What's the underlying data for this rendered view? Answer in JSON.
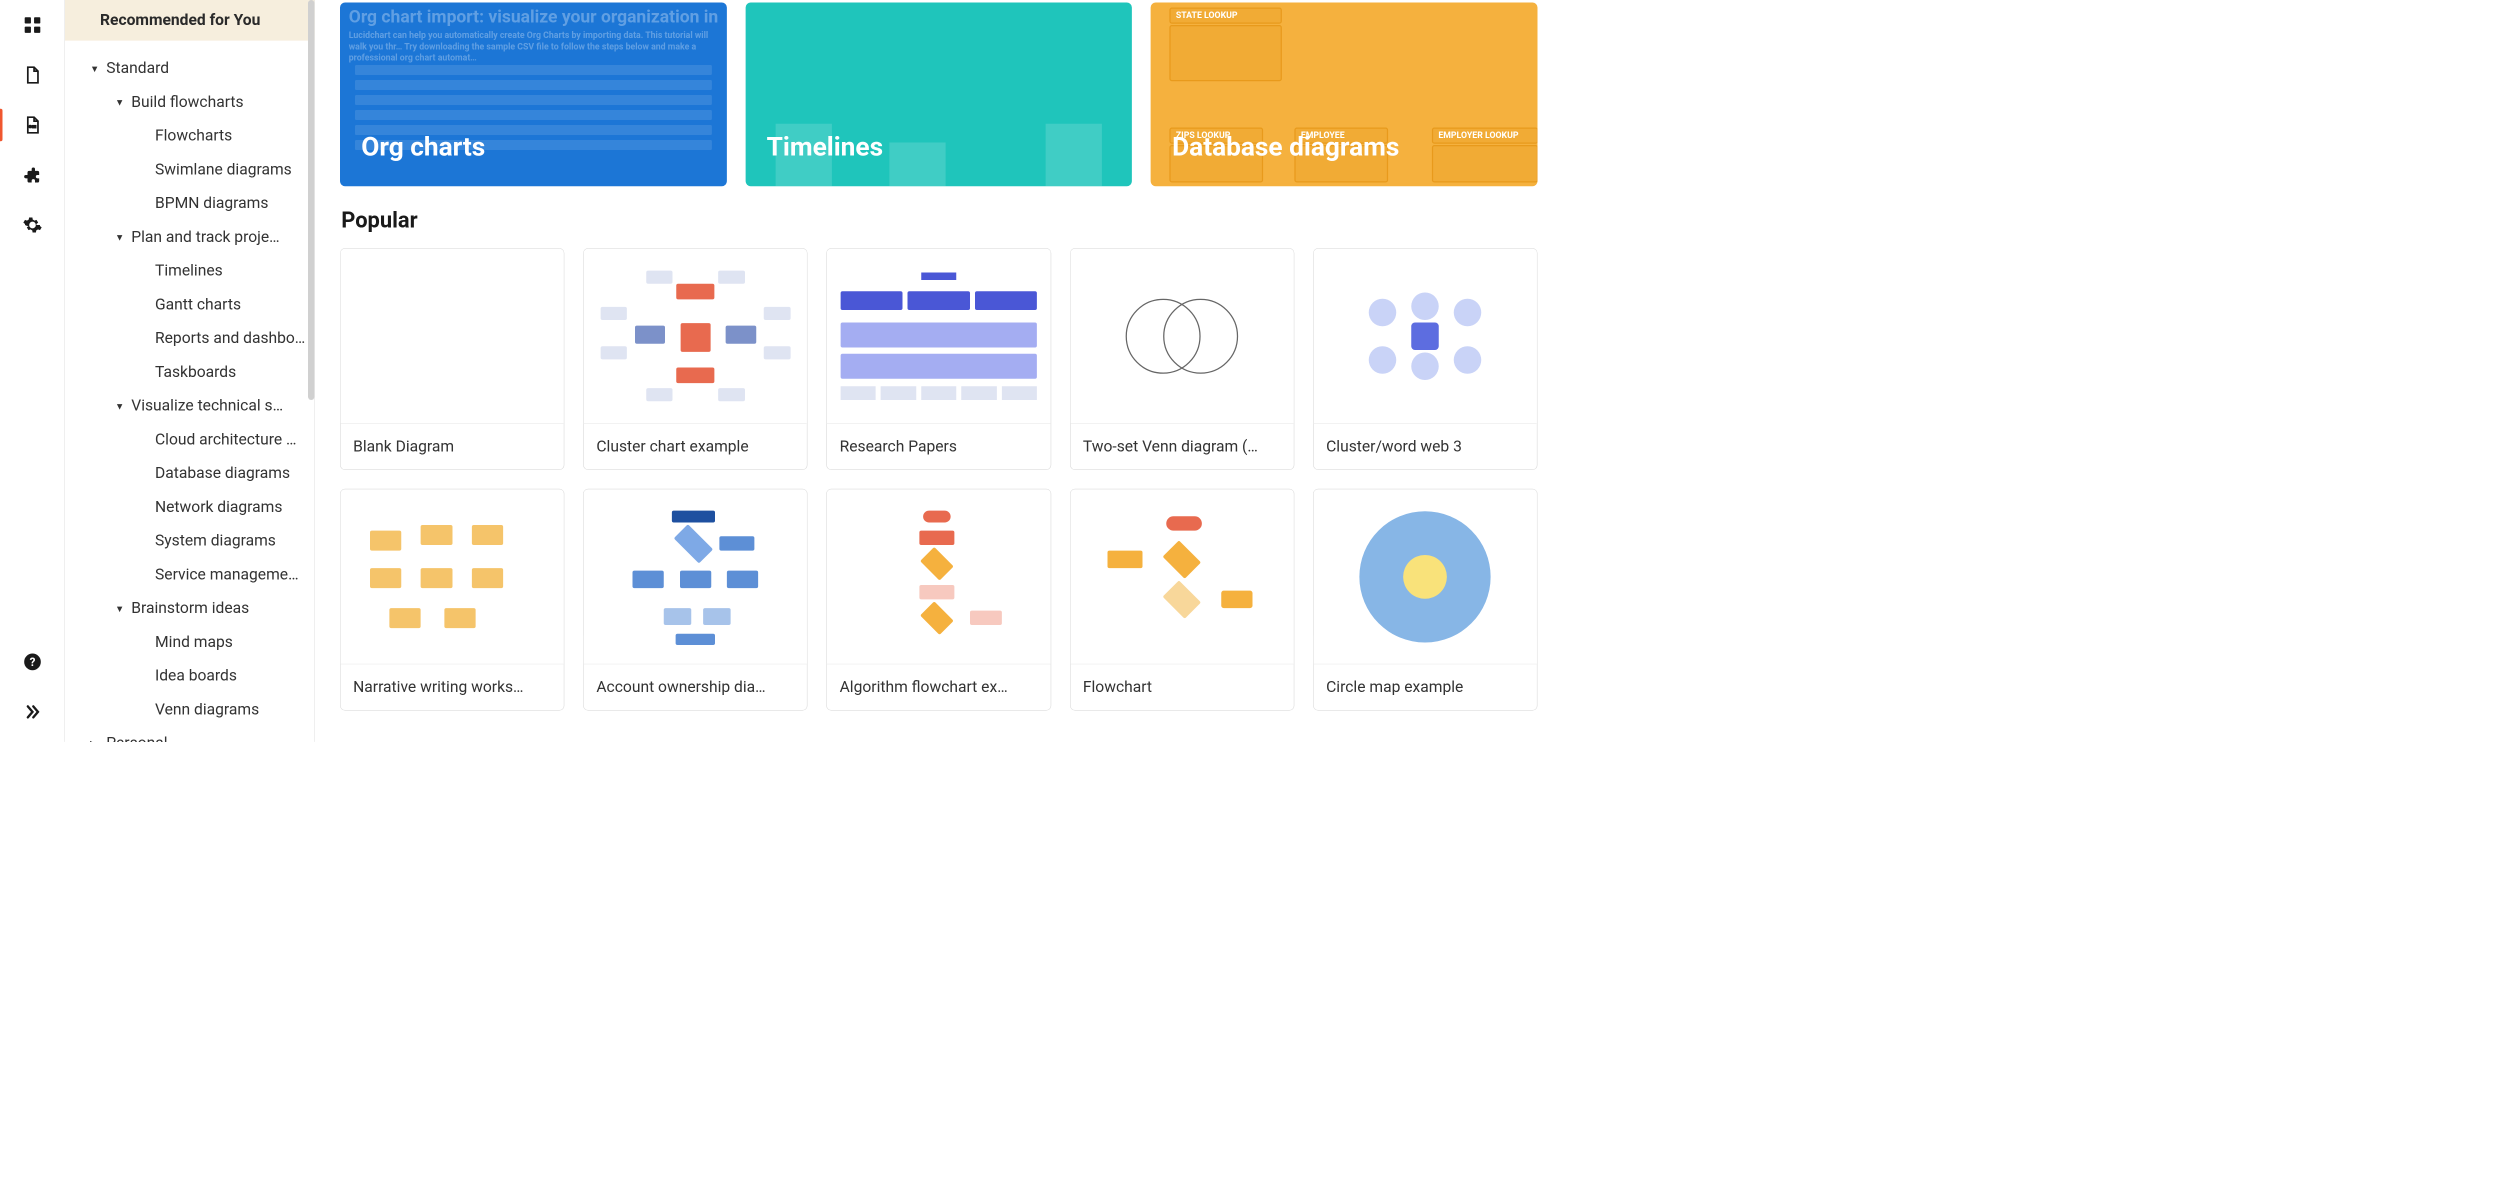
{
  "sidebar": {
    "recommended": "Recommended for You",
    "tree": [
      {
        "level": 0,
        "label": "Standard",
        "arrow": "down"
      },
      {
        "level": 1,
        "label": "Build flowcharts",
        "arrow": "down"
      },
      {
        "level": 2,
        "label": "Flowcharts",
        "arrow": ""
      },
      {
        "level": 2,
        "label": "Swimlane diagrams",
        "arrow": ""
      },
      {
        "level": 2,
        "label": "BPMN diagrams",
        "arrow": ""
      },
      {
        "level": 1,
        "label": "Plan and track proje…",
        "arrow": "down"
      },
      {
        "level": 2,
        "label": "Timelines",
        "arrow": ""
      },
      {
        "level": 2,
        "label": "Gantt charts",
        "arrow": ""
      },
      {
        "level": 2,
        "label": "Reports and dashbo…",
        "arrow": ""
      },
      {
        "level": 2,
        "label": "Taskboards",
        "arrow": ""
      },
      {
        "level": 1,
        "label": "Visualize technical s…",
        "arrow": "down"
      },
      {
        "level": 2,
        "label": "Cloud architecture …",
        "arrow": ""
      },
      {
        "level": 2,
        "label": "Database diagrams",
        "arrow": ""
      },
      {
        "level": 2,
        "label": "Network diagrams",
        "arrow": ""
      },
      {
        "level": 2,
        "label": "System diagrams",
        "arrow": ""
      },
      {
        "level": 2,
        "label": "Service manageme…",
        "arrow": ""
      },
      {
        "level": 1,
        "label": "Brainstorm ideas",
        "arrow": "down"
      },
      {
        "level": 2,
        "label": "Mind maps",
        "arrow": ""
      },
      {
        "level": 2,
        "label": "Idea boards",
        "arrow": ""
      },
      {
        "level": 2,
        "label": "Venn diagrams",
        "arrow": ""
      },
      {
        "level": 0,
        "label": "Personal",
        "arrow": "right"
      }
    ]
  },
  "hero": {
    "orgcharts": {
      "title": "Org charts",
      "bg_headline": "Org chart import: visualize your organization in se",
      "bg_sub": "Lucidchart can help you automatically create Org Charts by importing data. This tutorial will walk you thr… Try downloading the sample CSV file to follow the steps below and make a professional org chart automat…"
    },
    "timelines": {
      "title": "Timelines"
    },
    "database": {
      "title": "Database diagrams",
      "labels": {
        "lookup": "STATE LOOKUP",
        "employee": "EMPLOYEE",
        "employer": "EMPLOYER LOOKUP",
        "zip": "ZIPS LOOKUP"
      }
    }
  },
  "sections": {
    "popular": "Popular"
  },
  "cards": {
    "row1": [
      {
        "label": "Blank Diagram"
      },
      {
        "label": "Cluster chart example"
      },
      {
        "label": "Research Papers"
      },
      {
        "label": "Two-set Venn diagram (…"
      },
      {
        "label": "Cluster/word web 3"
      }
    ],
    "row2": [
      {
        "label": "Narrative writing works…"
      },
      {
        "label": "Account ownership dia…"
      },
      {
        "label": "Algorithm flowchart ex…"
      },
      {
        "label": "Flowchart"
      },
      {
        "label": "Circle map example"
      }
    ]
  },
  "rail_icons": [
    "dashboard",
    "document",
    "template",
    "puzzle",
    "gear",
    "help",
    "expand"
  ],
  "colors": {
    "accent": "#f0572f",
    "hero_blue": "#1c76d6",
    "hero_teal": "#1fc5bb",
    "hero_orange": "#f5b13e"
  }
}
